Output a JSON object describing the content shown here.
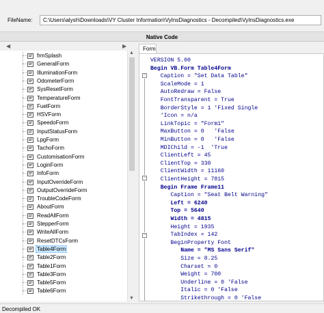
{
  "file": {
    "label": "FileName:",
    "path": "C:\\Users\\alysh\\Downloads\\VY Cluster Information\\VyInsDiagnostics - Decompiled\\VyInsDiagnostics.exe"
  },
  "panel": {
    "title": "Native Code"
  },
  "tree": {
    "items": [
      {
        "label": "frmSplash"
      },
      {
        "label": "GeneralForm"
      },
      {
        "label": "IlluminationForm"
      },
      {
        "label": "OdometerForm"
      },
      {
        "label": "SysResetForm"
      },
      {
        "label": "TemperatureForm"
      },
      {
        "label": "FuelForm"
      },
      {
        "label": "HSVForm"
      },
      {
        "label": "SpeedoForm"
      },
      {
        "label": "InputStatusForm"
      },
      {
        "label": "LpgForm"
      },
      {
        "label": "TachoForm"
      },
      {
        "label": "CustomisationForm"
      },
      {
        "label": "LoginForm"
      },
      {
        "label": "InfoForm"
      },
      {
        "label": "InputOverrideForm"
      },
      {
        "label": "OutputOverrideForm"
      },
      {
        "label": "TroubleCodeForm"
      },
      {
        "label": "AboutForm"
      },
      {
        "label": "ReadAllForm"
      },
      {
        "label": "StepperForm"
      },
      {
        "label": "WriteAllForm"
      },
      {
        "label": "ResetDTCsForm"
      },
      {
        "label": "Table4Form",
        "selected": true
      },
      {
        "label": "Table2Form"
      },
      {
        "label": "Table1Form"
      },
      {
        "label": "Table3Form"
      },
      {
        "label": "Table5Form"
      },
      {
        "label": "Table6Form"
      }
    ]
  },
  "code": {
    "tab_label": "Form",
    "lines": [
      "VERSION 5.00",
      "Begin VB.Form Table4Form",
      "   Caption = \"Set Data Table\"",
      "   ScaleMode = 1",
      "   AutoRedraw = False",
      "   FontTransparent = True",
      "   BorderStyle = 1 'Fixed Single",
      "   'Icon = n/a",
      "   LinkTopic = \"Form1\"",
      "   MaxButton = 0   'False",
      "   MinButton = 0   'False",
      "   MDIChild = -1  'True",
      "   ClientLeft = 45",
      "   ClientTop = 330",
      "   ClientWidth = 11160",
      "   ClientHeight = 7815",
      "   Begin Frame Frame11",
      "      Caption = \"Seat Belt Warning\"",
      "      Left = 6240",
      "      Top = 5640",
      "      Width = 4815",
      "      Height = 1935",
      "      TabIndex = 142",
      "      BeginProperty Font",
      "         Name = \"MS Sans Serif\"",
      "         Size = 8.25",
      "         Charset = 0",
      "         Weight = 700",
      "         Underline = 0 'False",
      "         Italic = 0 'False",
      "         Strikethrough = 0 'False"
    ]
  },
  "status": {
    "text": "Decompiled OK"
  }
}
